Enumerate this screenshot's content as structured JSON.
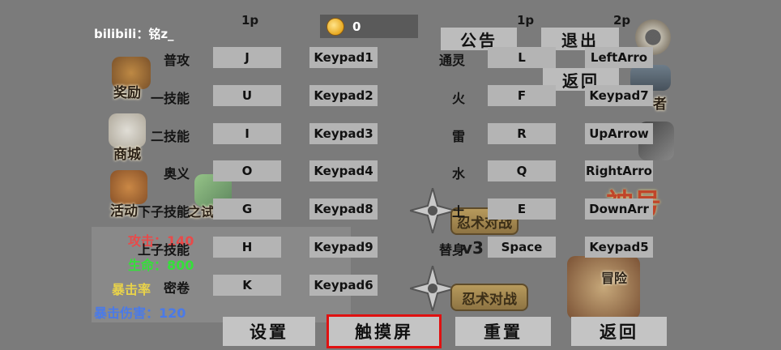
{
  "header": {
    "user_label": "bilibili：铭z_",
    "col_1p_left": "1p",
    "col_1p_right": "1p",
    "col_2p_right": "2p",
    "coins": "0"
  },
  "top_buttons": {
    "notice": "公告",
    "exit": "退出",
    "back": "返回"
  },
  "left_bindings": [
    {
      "action": "普攻",
      "key_1p": "J",
      "key_2p": "Keypad1"
    },
    {
      "action": "一技能",
      "key_1p": "U",
      "key_2p": "Keypad2"
    },
    {
      "action": "二技能",
      "key_1p": "I",
      "key_2p": "Keypad3"
    },
    {
      "action": "奥义",
      "key_1p": "O",
      "key_2p": "Keypad4"
    },
    {
      "action": "下子技能",
      "key_1p": "G",
      "key_2p": "Keypad8"
    },
    {
      "action": "上子技能",
      "key_1p": "H",
      "key_2p": "Keypad9"
    },
    {
      "action": "密卷",
      "key_1p": "K",
      "key_2p": "Keypad6"
    }
  ],
  "right_bindings": [
    {
      "action": "通灵",
      "key_1p": "L",
      "key_2p": "LeftArro"
    },
    {
      "action": "火",
      "key_1p": "F",
      "key_2p": "Keypad7"
    },
    {
      "action": "雷",
      "key_1p": "R",
      "key_2p": "UpArrow"
    },
    {
      "action": "水",
      "key_1p": "Q",
      "key_2p": "RightArro"
    },
    {
      "action": "土",
      "key_1p": "E",
      "key_2p": "DownArr"
    },
    {
      "action": "替身",
      "key_1p": "Space",
      "key_2p": "Keypad5"
    }
  ],
  "stats": {
    "attack": "攻击：140",
    "hp": "生命：800",
    "crit_rate": "暴击率",
    "crit_damage": "暴击伤害：120"
  },
  "bottom_buttons": {
    "settings": "设置",
    "touchscreen": "触摸屏",
    "reset": "重置",
    "back": "返回"
  },
  "background": {
    "rewards": "奖励",
    "shop": "商城",
    "activity": "活动",
    "activity_suffix": "之试",
    "ninja": "者",
    "battle_top": "忍术对战",
    "battle_bottom": "忍术对战",
    "version": "v3",
    "adventure": "冒险",
    "title_art": "神号"
  },
  "colors": {
    "background": "#7b7b7b",
    "key_box": "#b4b4b4",
    "attack": "#e84a4a",
    "hp": "#35e03a",
    "crit_rate": "#e8d24a",
    "crit_damage": "#4a7ae8",
    "selected_outline": "#e01010"
  }
}
